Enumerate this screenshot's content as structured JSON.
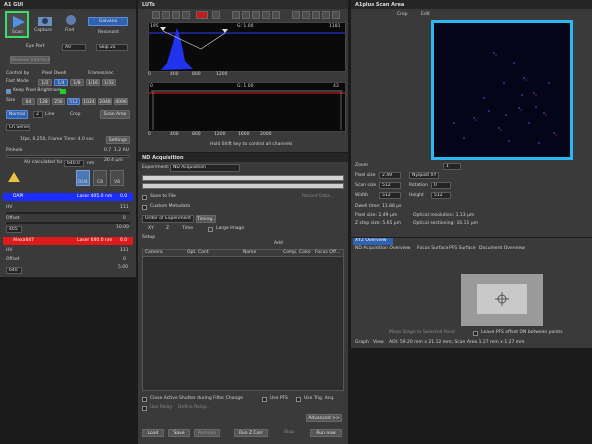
{
  "gui": {
    "title": "A1 GUI",
    "scan_label": "Scan",
    "capture_label": "Capture",
    "find_label": "Find",
    "galvano_label": "Galvano",
    "resonant_label": "Resonant",
    "eye_port_label": "Eye Port",
    "a_value": "A0",
    "skip_value": "Skip 2x",
    "remove_interlock_label": "Remove Interlock",
    "control_by_label": "Control by",
    "pixel_dwell_label": "Pixel Dwell",
    "frames_label": "Frames/sec",
    "fast_mode_label": "Fast Mode",
    "speed_values": [
      "1/2",
      "1/4",
      "1/8",
      "1/16",
      "1/32"
    ],
    "keep_pixel_label": "Keep Pixel Brightness",
    "size_label": "Size",
    "size_values": [
      "64",
      "128",
      "256",
      "512",
      "1024",
      "2048",
      "4096"
    ],
    "normal_label": "Normal",
    "avg_value": "2",
    "line_label": "Line",
    "crop_label": "Crop",
    "scan_area_label": "Scan Area",
    "ch_series_label": "Ch Series",
    "frame_time": "1fps, 0.250, Frame Time: 4.0 sec",
    "settings_label": "Settings",
    "pinhole_label": "Pinhole",
    "pinhole_value": "0.7",
    "pinhole_unit": "1.2 AU",
    "pinhole_value2": "20.4 µm",
    "au_calc_label": "AU calculated for",
    "au_calc_value": "640.0",
    "au_calc_unit": "nm",
    "dichroic_labels": [
      "DU4",
      "C8",
      "V8"
    ],
    "channels": [
      {
        "name": "DAPI",
        "laser": "Laser 405.0 nm",
        "laser_val": "0.0",
        "hv_label": "HV",
        "hv_value": "111",
        "offset_label": "Offset",
        "offset_value": "0",
        "laser_pct": "10.00",
        "wl": "405",
        "color": "#1a2cff"
      },
      {
        "name": "Alexa647",
        "laser": "Laser 640.0 nm",
        "laser_val": "6.0",
        "hv_label": "HV",
        "hv_value": "111",
        "offset_label": "Offset",
        "offset_value": "0",
        "laser_pct": "5.00",
        "wl": "640",
        "color": "#e01a1a"
      }
    ]
  },
  "luts": {
    "title": "LUTs",
    "ch1_g": "G: 1.00",
    "ch1_max": "1181",
    "ch1_min": "195",
    "ch2_g": "G: 1.00",
    "ch2_max": "43",
    "ch2_min": "0",
    "ticks": [
      "0",
      "400",
      "800",
      "1200",
      "1600",
      "2000"
    ],
    "hint": "Hold Shift key to control all channels"
  },
  "nd": {
    "title": "ND Acquisition",
    "experiment_label": "Experiment:",
    "experiment_value": "ND Acquisition",
    "save_to_file": "Save to File",
    "record_data": "Record Data...",
    "custom_metadata": "Custom Metadata",
    "order_label": "Order of Experiment",
    "timing_label": "Timing...",
    "xy_label": "XY",
    "z_label": "Z",
    "time_label": "Time",
    "large_image_label": "Large Image",
    "setup_label": "Setup",
    "add_label": "Add",
    "columns": [
      "Camera",
      "Opt. Conf.",
      "Name",
      "Comp. Color",
      "Focus Off..."
    ],
    "close_shutter": "Close Active Shutter during Filter Change",
    "use_pfs": "Use PFS",
    "use_trig": "Use Trig. Acq.",
    "use_relay": "Use Relay",
    "define_relay": "Define Relay...",
    "advanced": "Advanced >>",
    "load": "Load",
    "save": "Save",
    "remove": "Remove",
    "run_z": "Run Z Corr",
    "stop_label": "Stop",
    "run_now": "Run now"
  },
  "scan_area": {
    "title": "A1plus Scan Area",
    "crop_label": "Crop",
    "edit_label": "Edit",
    "zoom_label": "Zoom",
    "zoom_value": "1",
    "pixel_size_label": "Pixel size",
    "pixel_size_value": "2.49",
    "nyquist_label": "Nyquist XY",
    "scan_size_label": "Scan size",
    "scan_size_value": "512",
    "rotation_label": "Rotation",
    "rotation_value": "0",
    "width_label": "Width",
    "width_value": "512",
    "height_label": "Height",
    "height_value": "512",
    "dwell_label": "Dwell time: 11.88 µs",
    "pixel_size_um": "Pixel size: 2.49 µm",
    "optical_res": "Optical resolution: 1.13 µm",
    "z_step": "Z step size: 5.65 µm",
    "optical_section": "Optical sectioning: 16.11 µm"
  },
  "xyz": {
    "title": "XYZ Overview",
    "tabs": [
      "ND Acquisition Overview",
      "Focus Surface",
      "PFS Surface",
      "Document Overview"
    ],
    "move_stage": "Move Stage to Selected Point",
    "leave_pfs": "Leave PFS offset ON between points",
    "graph_tab": "Graph",
    "view_tab": "View",
    "status": "AOI: 59.20 mm x 21.12 mm; Scan Area 1.27 mm x 1.27 mm"
  }
}
